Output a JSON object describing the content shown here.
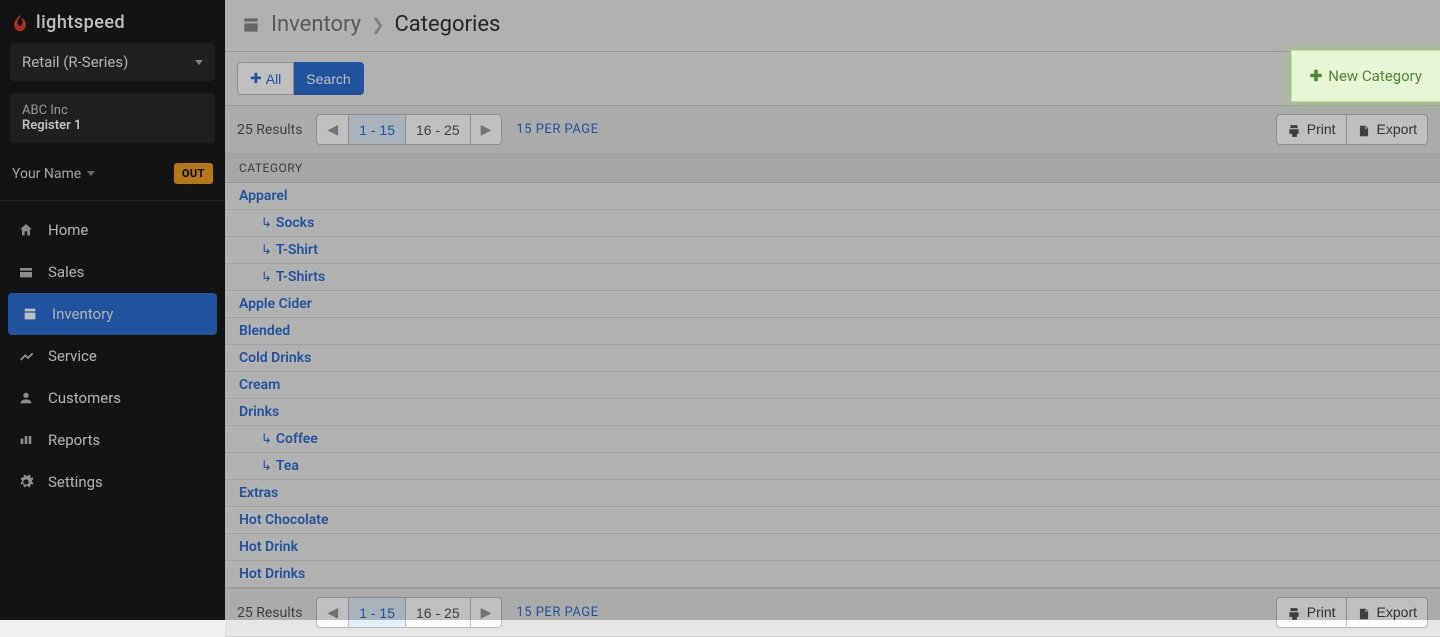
{
  "brand": "lightspeed",
  "product_selector": {
    "label": "Retail (R-Series)"
  },
  "company": {
    "name": "ABC Inc",
    "register": "Register 1"
  },
  "user": {
    "name": "Your Name",
    "status_badge": "OUT"
  },
  "nav": {
    "items": [
      {
        "label": "Home",
        "icon": "home-icon"
      },
      {
        "label": "Sales",
        "icon": "sales-icon"
      },
      {
        "label": "Inventory",
        "icon": "inventory-icon",
        "active": true
      },
      {
        "label": "Service",
        "icon": "service-icon"
      },
      {
        "label": "Customers",
        "icon": "customers-icon"
      },
      {
        "label": "Reports",
        "icon": "reports-icon"
      },
      {
        "label": "Settings",
        "icon": "settings-icon"
      }
    ]
  },
  "breadcrumb": {
    "parent": "Inventory",
    "current": "Categories"
  },
  "toolbar": {
    "all": "All",
    "search": "Search",
    "new_category": "New Category"
  },
  "pagination": {
    "results_text": "25 Results",
    "pages": [
      "1 - 15",
      "16 - 25"
    ],
    "per_page": "15 PER PAGE",
    "print": "Print",
    "export": "Export"
  },
  "table": {
    "header": "CATEGORY",
    "rows": [
      {
        "label": "Apparel",
        "child": false
      },
      {
        "label": "Socks",
        "child": true
      },
      {
        "label": "T-Shirt",
        "child": true
      },
      {
        "label": "T-Shirts",
        "child": true
      },
      {
        "label": "Apple Cider",
        "child": false
      },
      {
        "label": "Blended",
        "child": false
      },
      {
        "label": "Cold Drinks",
        "child": false
      },
      {
        "label": "Cream",
        "child": false
      },
      {
        "label": "Drinks",
        "child": false
      },
      {
        "label": "Coffee",
        "child": true
      },
      {
        "label": "Tea",
        "child": true
      },
      {
        "label": "Extras",
        "child": false
      },
      {
        "label": "Hot Chocolate",
        "child": false
      },
      {
        "label": "Hot Drink",
        "child": false
      },
      {
        "label": "Hot Drinks",
        "child": false
      }
    ]
  }
}
